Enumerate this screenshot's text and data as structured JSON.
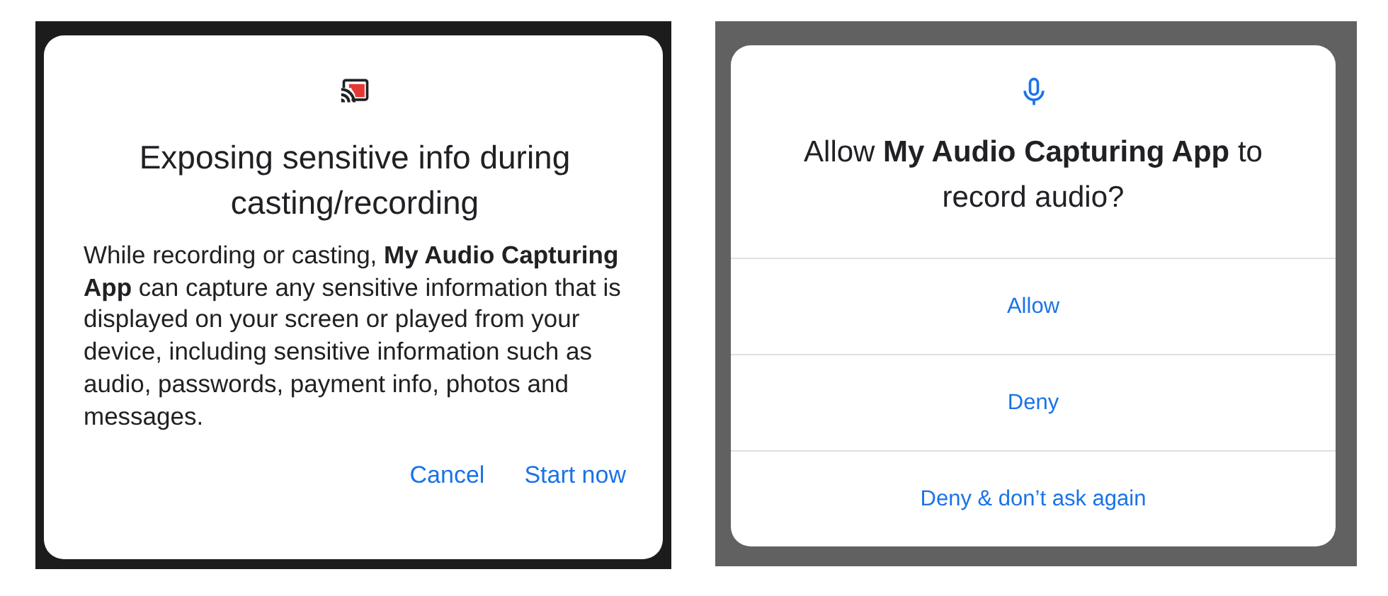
{
  "dialogs": [
    {
      "kind": "cast",
      "title": "Exposing sensitive info during casting/recording",
      "message": "While recording or casting, **My Audio Capturing App** can capture any sensitive information that is displayed on your screen or played from your device, including sensitive information such as audio, passwords, payment info, photos and messages.",
      "buttons": [
        "Cancel",
        "Start now"
      ]
    },
    {
      "kind": "mic",
      "title": "Allow **My Audio Capturing App** to record audio?",
      "buttons": [
        "Allow",
        "Deny",
        "Deny & don’t ask again"
      ]
    }
  ]
}
